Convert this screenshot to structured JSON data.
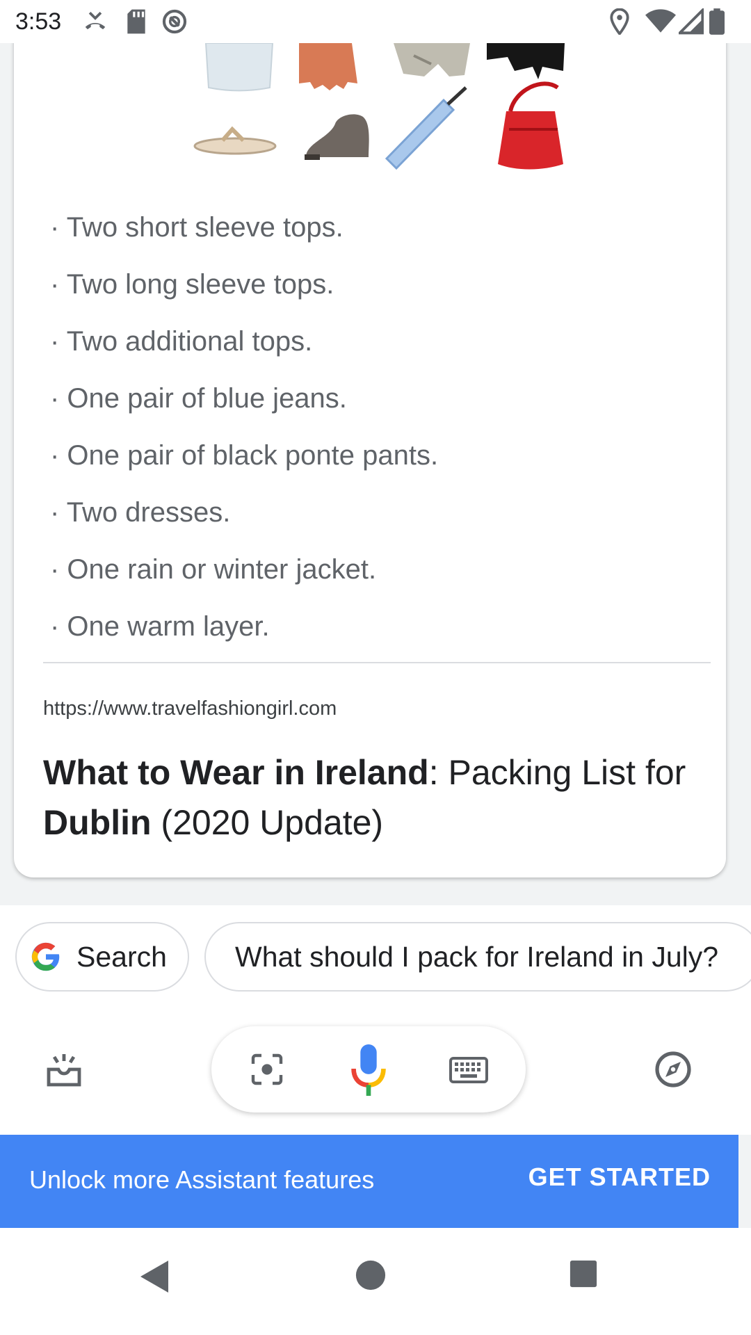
{
  "status_bar": {
    "time": "3:53",
    "left_icons": [
      "missed-call-icon",
      "sd-card-icon",
      "do-not-disturb-icon"
    ],
    "right_icons": [
      "location-icon",
      "wifi-icon",
      "cellular-signal-icon",
      "battery-icon"
    ]
  },
  "result_card": {
    "thumbnail_icons": [
      "tank-top-icon",
      "skirt-icon",
      "trench-coat-icon",
      "leather-jacket-icon",
      "sandal-icon",
      "ankle-boot-icon",
      "umbrella-icon",
      "crossbody-bag-icon"
    ],
    "list_items": [
      "· Two short sleeve tops.",
      "· Two long sleeve tops.",
      "· Two additional tops.",
      "· One pair of blue jeans.",
      "· One pair of black ponte pants.",
      "· Two dresses.",
      "· One rain or winter jacket.",
      "· One warm layer."
    ],
    "source_url": "https://www.travelfashiongirl.com",
    "title_bold_1": "What to Wear in Ireland",
    "title_plain_1": ": Packing List for ",
    "title_bold_2": "Dublin",
    "title_plain_2": " (2020 Update)"
  },
  "suggestions": {
    "search_label": "Search",
    "query_label": "What should I pack for Ireland in July?"
  },
  "toolbar": {
    "icons": [
      "updates-tray-icon",
      "lens-icon",
      "microphone-icon",
      "keyboard-icon",
      "explore-compass-icon"
    ]
  },
  "promo": {
    "text": "Unlock more Assistant features",
    "button": "GET STARTED",
    "color": "#4285f4"
  },
  "nav": {
    "icons": [
      "back-icon",
      "home-icon",
      "recents-icon"
    ]
  }
}
